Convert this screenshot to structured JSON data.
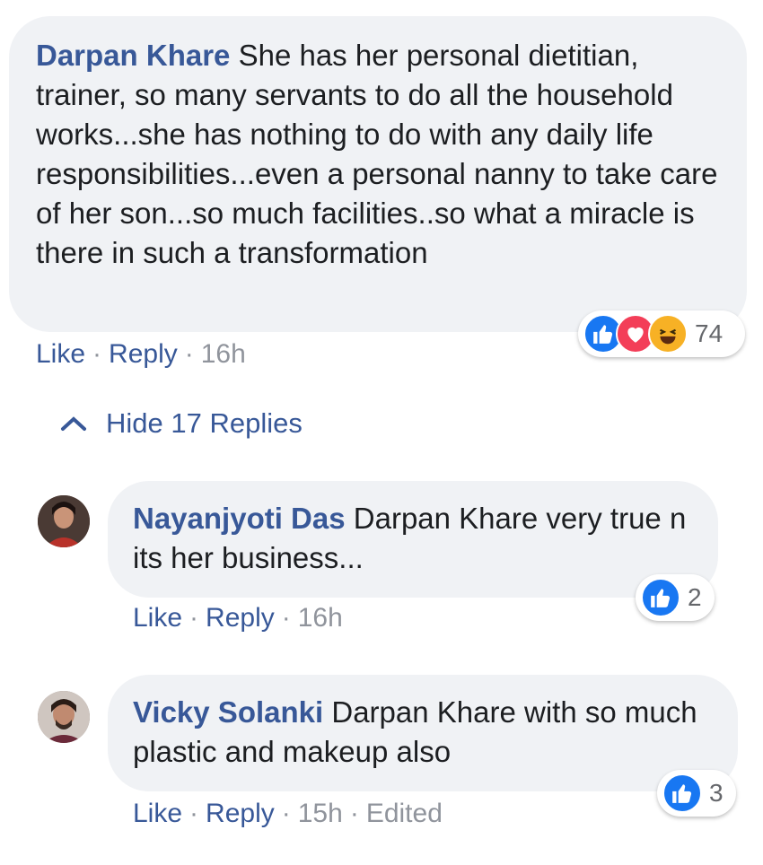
{
  "comment": {
    "author": "Darpan Khare",
    "text": "She has her personal dietitian, trainer, so many servants to do all the household works...she has nothing to do with any daily life responsibilities...even a personal nanny to take care of her son...so much facilities..so what a miracle is there in such a transformation",
    "like": "Like",
    "reply": "Reply",
    "time": "16h",
    "reaction_count": "74",
    "reactions": [
      "like-icon",
      "love-icon",
      "haha-icon"
    ]
  },
  "hide_replies": "Hide 17 Replies",
  "replies": [
    {
      "author": "Nayanjyoti Das",
      "text": "Darpan Khare very true n its her business...",
      "like": "Like",
      "reply": "Reply",
      "time": "16h",
      "reaction_count": "2"
    },
    {
      "author": "Vicky Solanki",
      "text": "Darpan Khare with so much plastic and makeup also",
      "like": "Like",
      "reply": "Reply",
      "time": "15h",
      "edited": "Edited",
      "reaction_count": "3"
    }
  ],
  "colors": {
    "link": "#385898",
    "bubble": "#f0f2f5",
    "like_blue": "#1877f2",
    "love_red": "#f33e58",
    "haha_yellow": "#f7b125"
  }
}
